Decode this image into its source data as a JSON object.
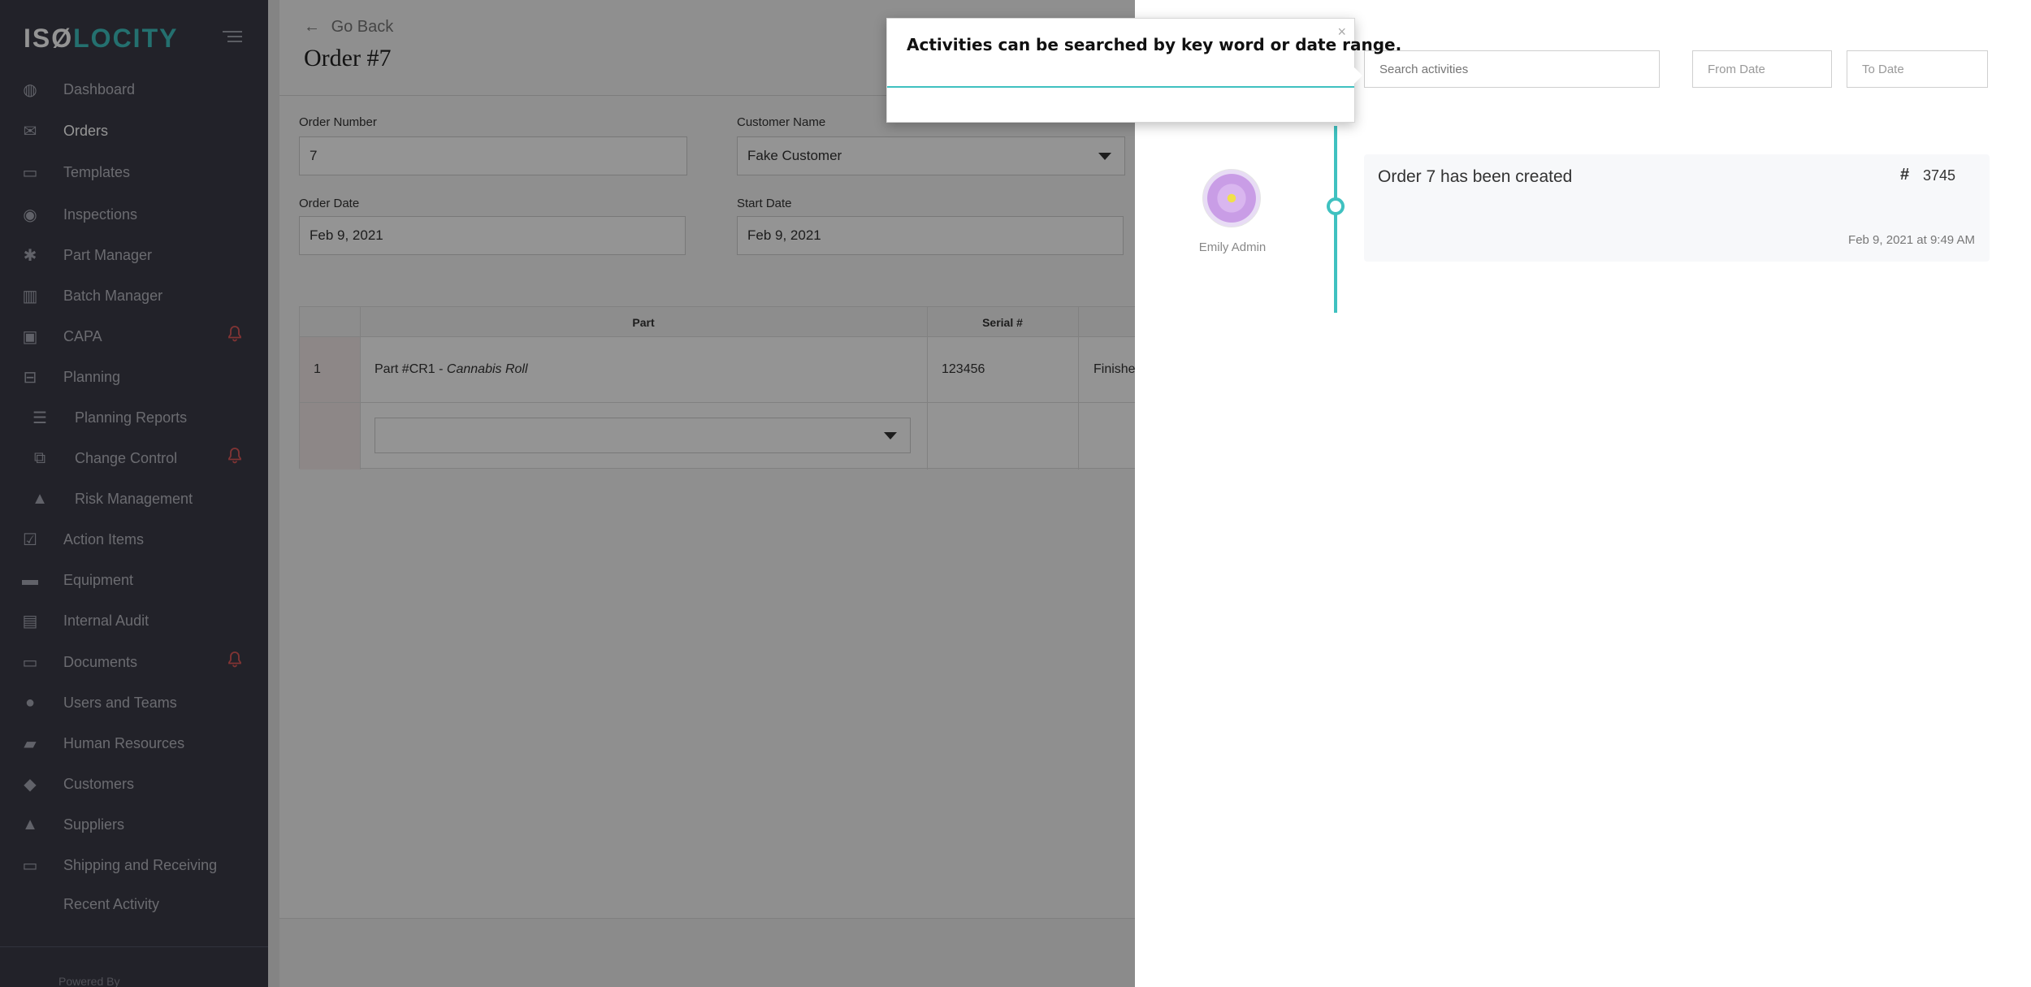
{
  "app": {
    "logo_left": "ISØ",
    "logo_right": "LOCITY",
    "powered_by": "Powered By"
  },
  "sidebar": {
    "items": [
      {
        "label": "Dashboard",
        "icon": "palette-icon"
      },
      {
        "label": "Orders",
        "icon": "inbox-icon",
        "active": true
      },
      {
        "label": "Templates",
        "icon": "image-icon"
      },
      {
        "label": "Inspections",
        "icon": "eye-icon"
      },
      {
        "label": "Part Manager",
        "icon": "gear-icon"
      },
      {
        "label": "Batch Manager",
        "icon": "barcode-icon"
      },
      {
        "label": "CAPA",
        "icon": "briefcase-icon",
        "alert": true
      },
      {
        "label": "Planning",
        "icon": "map-icon"
      },
      {
        "label": "Planning Reports",
        "icon": "report-icon",
        "sub": true
      },
      {
        "label": "Change Control",
        "icon": "copy-icon",
        "sub": true,
        "alert": true
      },
      {
        "label": "Risk Management",
        "icon": "warning-icon",
        "sub": true
      },
      {
        "label": "Action Items",
        "icon": "check-square-icon"
      },
      {
        "label": "Equipment",
        "icon": "truck-icon"
      },
      {
        "label": "Internal Audit",
        "icon": "file-icon"
      },
      {
        "label": "Documents",
        "icon": "folder-icon",
        "alert": true
      },
      {
        "label": "Users and Teams",
        "icon": "users-icon"
      },
      {
        "label": "Human Resources",
        "icon": "book-icon"
      },
      {
        "label": "Customers",
        "icon": "tag-icon"
      },
      {
        "label": "Suppliers",
        "icon": "ship-icon"
      },
      {
        "label": "Shipping and Receiving",
        "icon": "tray-icon"
      },
      {
        "label": "Recent Activity",
        "icon": ""
      }
    ]
  },
  "order": {
    "go_back": "Go Back",
    "title": "Order #7",
    "fields": {
      "order_number_label": "Order Number",
      "order_number_value": "7",
      "customer_name_label": "Customer Name",
      "customer_name_value": "Fake Customer",
      "order_date_label": "Order Date",
      "order_date_value": "Feb 9, 2021",
      "start_date_label": "Start Date",
      "start_date_value": "Feb 9, 2021"
    },
    "table": {
      "headers": {
        "part": "Part",
        "serial": "Serial #"
      },
      "rows": [
        {
          "num": "1",
          "part_prefix": "Part #CR1 - ",
          "part_name": "Cannabis Roll",
          "serial": "123456",
          "status": "Finishe"
        }
      ]
    }
  },
  "activity_panel": {
    "search_placeholder": "Search activities",
    "from_date_placeholder": "From Date",
    "to_date_placeholder": "To Date",
    "entry": {
      "user": "Emily Admin",
      "title": "Order 7 has been created",
      "hash": "#",
      "id": "3745",
      "timestamp": "Feb 9, 2021 at 9:49 AM"
    }
  },
  "tooltip": {
    "text": "Activities can be searched by key word or date range.",
    "close": "×"
  },
  "colors": {
    "accent": "#3fc1c0",
    "sidebar_bg": "#3b3c47",
    "alert": "#e05a5a"
  }
}
